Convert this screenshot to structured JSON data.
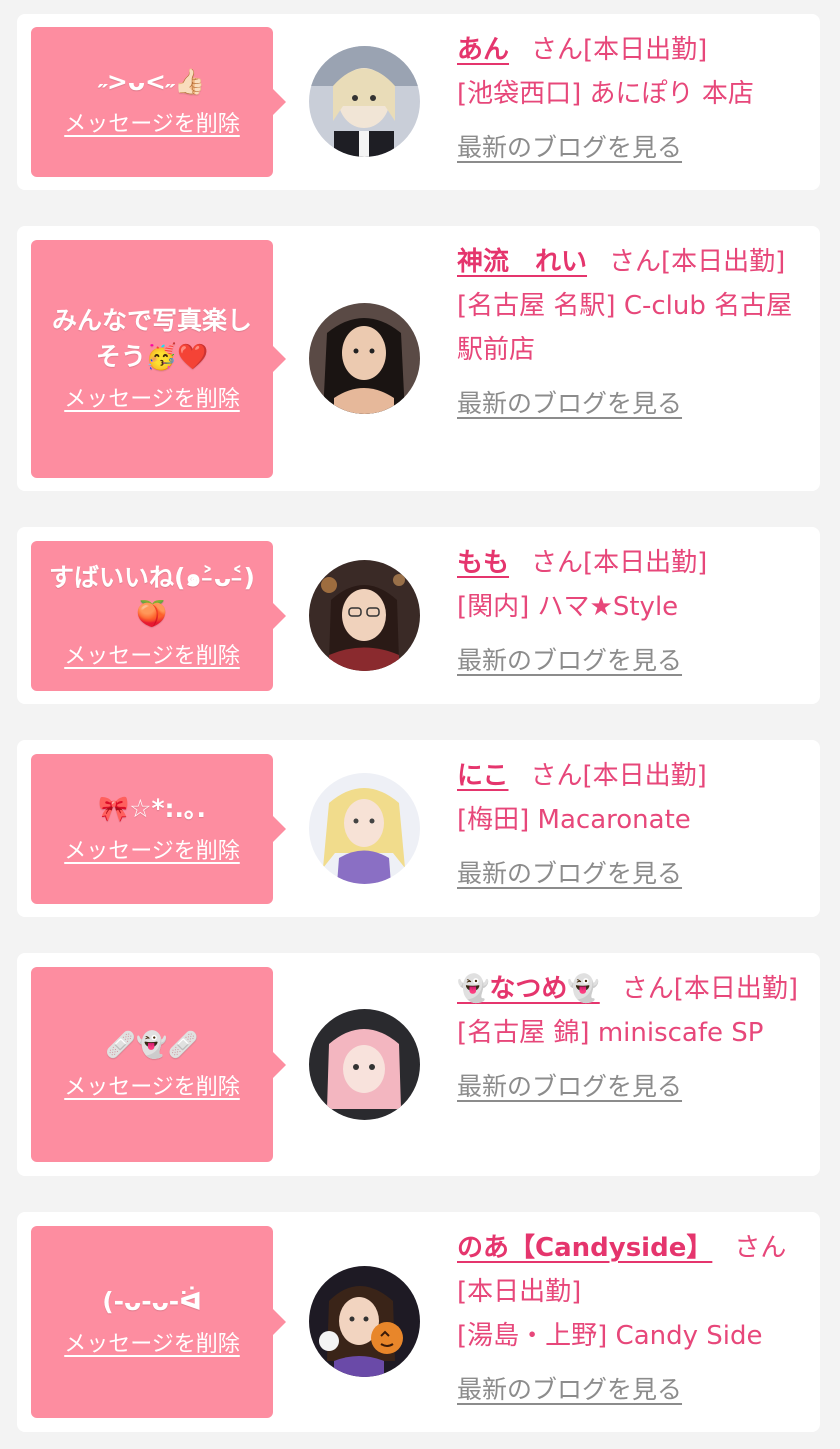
{
  "common": {
    "delete_label": "メッセージを削除",
    "blog_label": "最新のブログを見る",
    "san": "さん",
    "status": "[本日出勤]"
  },
  "colors": {
    "bubble": "#fd8da0",
    "name": "#e5356d",
    "text": "#e7477a",
    "link_gray": "#8c8c8c",
    "page_bg": "#f3f3f3"
  },
  "cards": [
    {
      "message": "˶>ᴗ<˶👍🏻",
      "name": "あん",
      "shop": "[池袋西口] あにぽり 本店"
    },
    {
      "message": "みんなで写真楽しそう🥳❤️",
      "name": "神流　れい",
      "shop": "[名古屋 名駅] C-club 名古屋駅前店"
    },
    {
      "message": "すばいいね(๑˃̵ᴗ˂̵)🍑",
      "name": "もも",
      "shop": "[関内] ハマ★Style"
    },
    {
      "message": "🎀☆*:.｡.",
      "name": "にこ",
      "shop": "[梅田] Macaronate"
    },
    {
      "message": "🩹👻🩹",
      "name": "👻なつめ👻",
      "shop": "[名古屋 錦] miniscafe SP"
    },
    {
      "message": "(-ᴗ-ᴗ-ᐛ",
      "name": "のあ【Candyside】",
      "shop": "[湯島・上野] Candy Side"
    }
  ]
}
